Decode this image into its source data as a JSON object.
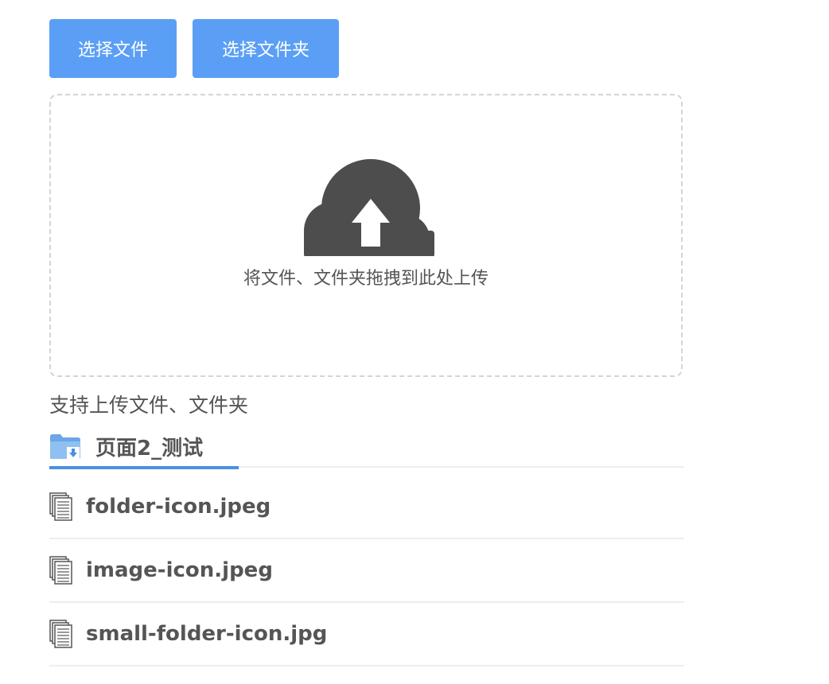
{
  "buttons": {
    "select_file": "选择文件",
    "select_folder": "选择文件夹"
  },
  "dropzone": {
    "text": "将文件、文件夹拖拽到此处上传",
    "icon": "upload-cloud-icon"
  },
  "hint": "支持上传文件、文件夹",
  "tab": {
    "label": "页面2_测试",
    "icon": "folder-download-icon"
  },
  "files": [
    {
      "name": "folder-icon.jpeg",
      "icon": "document-icon"
    },
    {
      "name": "image-icon.jpeg",
      "icon": "document-icon"
    },
    {
      "name": "small-folder-icon.jpg",
      "icon": "document-icon"
    }
  ],
  "colors": {
    "button": "#5a9ff5",
    "tab_underline": "#4a90e2",
    "cloud": "#4d4d4d"
  }
}
